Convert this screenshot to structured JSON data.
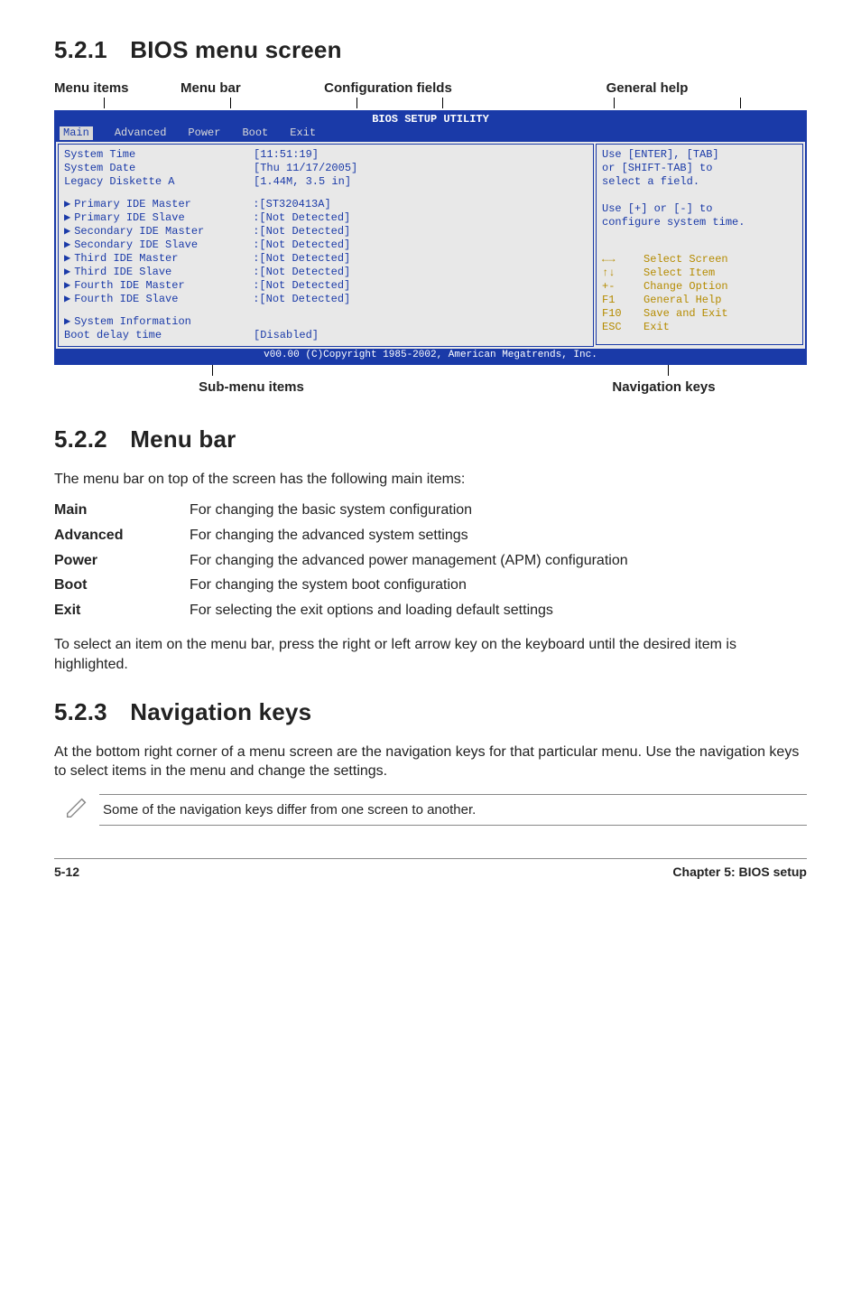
{
  "page": {
    "number": "5-12",
    "chapter": "Chapter 5: BIOS setup"
  },
  "s521": {
    "num": "5.2.1",
    "title": "BIOS menu screen",
    "annot_top": {
      "a1": "Menu items",
      "a2": "Menu bar",
      "a3": "Configuration fields",
      "a4": "General help"
    },
    "annot_bottom": {
      "b1": "Sub-menu items",
      "b2": "Navigation keys"
    }
  },
  "bios": {
    "title": "BIOS SETUP UTILITY",
    "menubar": [
      "Main",
      "Advanced",
      "Power",
      "Boot",
      "Exit"
    ],
    "selected_tab": "Main",
    "left_groups": {
      "top": [
        {
          "lbl": "System Time",
          "val": "[11:51:19]"
        },
        {
          "lbl": "System Date",
          "val": "[Thu 11/17/2005]"
        },
        {
          "lbl": "Legacy Diskette A",
          "val": "[1.44M, 3.5 in]"
        }
      ],
      "ide": [
        {
          "lbl": "Primary IDE Master",
          "val": ":[ST320413A]"
        },
        {
          "lbl": "Primary IDE Slave",
          "val": ":[Not Detected]"
        },
        {
          "lbl": "Secondary IDE Master",
          "val": ":[Not Detected]"
        },
        {
          "lbl": "Secondary IDE Slave",
          "val": ":[Not Detected]"
        },
        {
          "lbl": "Third IDE Master",
          "val": ":[Not Detected]"
        },
        {
          "lbl": "Third IDE Slave",
          "val": ":[Not Detected]"
        },
        {
          "lbl": "Fourth IDE Master",
          "val": ":[Not Detected]"
        },
        {
          "lbl": "Fourth IDE Slave",
          "val": ":[Not Detected]"
        }
      ],
      "bottom": [
        {
          "lbl": "System Information",
          "val": "",
          "arrow": true
        },
        {
          "lbl": "Boot delay time",
          "val": "[Disabled]",
          "arrow": false
        }
      ]
    },
    "help_top": [
      "Use [ENTER], [TAB]",
      "or [SHIFT-TAB] to",
      "select a field.",
      "",
      "Use [+] or [-] to",
      "configure system time."
    ],
    "nav": [
      {
        "k": "←→",
        "v": "Select Screen"
      },
      {
        "k": "↑↓",
        "v": "Select Item"
      },
      {
        "k": "+-",
        "v": "Change Option"
      },
      {
        "k": "F1",
        "v": "General Help"
      },
      {
        "k": "F10",
        "v": "Save and Exit"
      },
      {
        "k": "ESC",
        "v": "Exit"
      }
    ],
    "footer": "v00.00 (C)Copyright 1985-2002, American Megatrends, Inc."
  },
  "s522": {
    "num": "5.2.2",
    "title": "Menu bar",
    "intro": "The menu bar on top of the screen has the following main items:",
    "rows": [
      {
        "k": "Main",
        "v": "For changing the basic system configuration"
      },
      {
        "k": "Advanced",
        "v": "For changing the advanced system settings"
      },
      {
        "k": "Power",
        "v": "For changing the advanced power management (APM) configuration"
      },
      {
        "k": "Boot",
        "v": "For changing the system boot configuration"
      },
      {
        "k": "Exit",
        "v": "For selecting the exit options and loading default settings"
      }
    ],
    "after": "To select an item on the menu bar, press the right or left arrow key on the keyboard until the desired item is highlighted."
  },
  "s523": {
    "num": "5.2.3",
    "title": "Navigation keys",
    "body": "At the bottom right corner of a menu screen are the navigation keys for that particular menu. Use the navigation keys to select items in the menu and change the settings.",
    "note": "Some of the navigation keys differ from one screen to another."
  }
}
